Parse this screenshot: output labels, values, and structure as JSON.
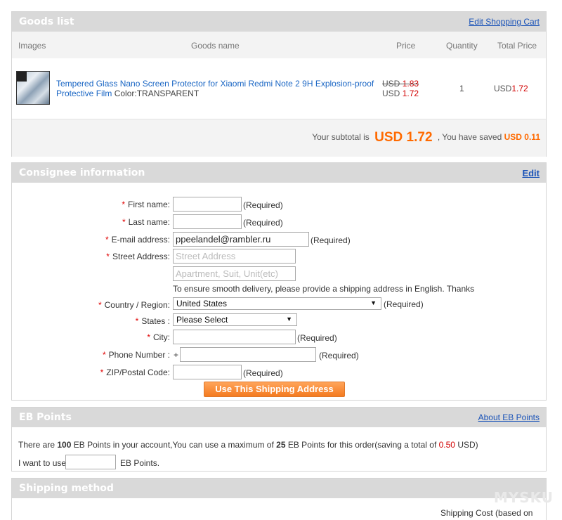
{
  "goods": {
    "title": "Goods list",
    "edit_link": "Edit Shopping Cart",
    "columns": {
      "images": "Images",
      "name": "Goods name",
      "price": "Price",
      "quantity": "Quantity",
      "total": "Total Price"
    },
    "item": {
      "name": "Tempered Glass Nano Screen Protector for Xiaomi Redmi Note 2 9H Explosion-proof Protective Film",
      "variant": "Color:TRANSPARENT",
      "old_price_currency": "USD",
      "old_price": "1.83",
      "price_currency": "USD",
      "price": "1.72",
      "quantity": "1",
      "total_currency": "USD",
      "total": "1.72"
    },
    "subtotal_prefix": "Your subtotal is",
    "subtotal_value": "USD 1.72",
    "saved_prefix": ", You have saved",
    "saved_value": "USD 0.11"
  },
  "consignee": {
    "title": "Consignee information",
    "edit_link": "Edit",
    "required": "(Required)",
    "first_name_label": "First name:",
    "last_name_label": "Last name:",
    "email_label": "E-mail address:",
    "email_value": "ppeelandel@rambler.ru",
    "street_label": "Street Address:",
    "street_placeholder": "Street Address",
    "apartment_placeholder": "Apartment, Suit, Unit(etc)",
    "note": "To ensure smooth delivery, please provide a shipping address in English. Thanks",
    "country_label": "Country / Region:",
    "country_value": "United States",
    "states_label": "States :",
    "states_value": "Please Select",
    "city_label": "City:",
    "phone_label": "Phone Number :",
    "phone_prefix": "+",
    "zip_label": "ZIP/Postal Code:",
    "submit_label": "Use This Shipping Address"
  },
  "eb_points": {
    "title": "EB Points",
    "about_link": "About EB Points",
    "line_part1": "There are",
    "points_total": "100",
    "line_part2": "EB Points in your account,You can use a maximum of",
    "points_max": "25",
    "line_part3": "EB Points for this order(saving a total of",
    "saving_amount": "0.50",
    "line_part4": "USD)",
    "use_label": "I want to use",
    "use_suffix": "EB Points."
  },
  "shipping": {
    "title": "Shipping method",
    "cost_header": "Shipping Cost (based on"
  },
  "watermark": "MYSKU"
}
